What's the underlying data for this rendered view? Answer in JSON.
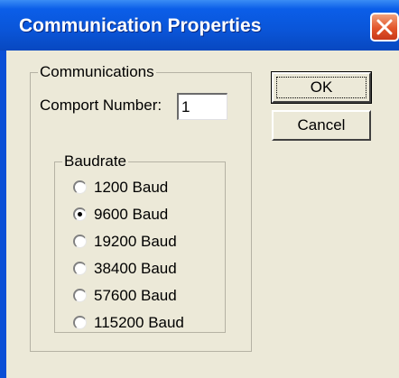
{
  "window": {
    "title": "Communication Properties",
    "close_icon": "close-icon"
  },
  "communications": {
    "group_label": "Communications",
    "comport_label": "Comport Number:",
    "comport_value": "1"
  },
  "baudrate": {
    "group_label": "Baudrate",
    "options": [
      {
        "label": "1200 Baud",
        "selected": false
      },
      {
        "label": "9600 Baud",
        "selected": true
      },
      {
        "label": "19200 Baud",
        "selected": false
      },
      {
        "label": "38400 Baud",
        "selected": false
      },
      {
        "label": "57600 Baud",
        "selected": false
      },
      {
        "label": "115200 Baud",
        "selected": false
      }
    ]
  },
  "buttons": {
    "ok": "OK",
    "cancel": "Cancel"
  }
}
